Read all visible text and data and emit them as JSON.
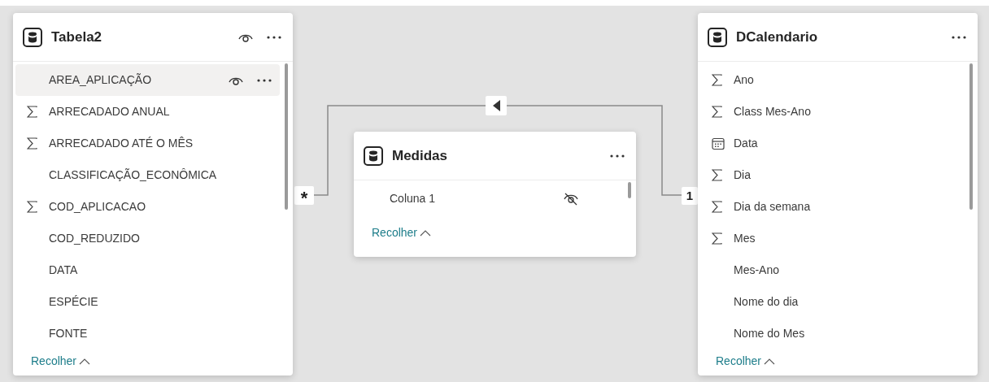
{
  "tables": [
    {
      "title": "Tabela2",
      "visibility_icon": true,
      "collapse_label": "Recolher",
      "fields": [
        {
          "name": "AREA_APLICAÇÃO",
          "kind": "text",
          "selected": true,
          "hidden": false
        },
        {
          "name": "ARRECADADO ANUAL",
          "kind": "sum",
          "selected": false,
          "hidden": false
        },
        {
          "name": "ARRECADADO ATÉ O MÊS",
          "kind": "sum",
          "selected": false,
          "hidden": false
        },
        {
          "name": "CLASSIFICAÇÃO_ECONÔMICA",
          "kind": "text",
          "selected": false,
          "hidden": false
        },
        {
          "name": "COD_APLICACAO",
          "kind": "sum",
          "selected": false,
          "hidden": false
        },
        {
          "name": "COD_REDUZIDO",
          "kind": "text",
          "selected": false,
          "hidden": false
        },
        {
          "name": "DATA",
          "kind": "text",
          "selected": false,
          "hidden": false
        },
        {
          "name": "ESPÉCIE",
          "kind": "text",
          "selected": false,
          "hidden": false
        },
        {
          "name": "FONTE",
          "kind": "text",
          "selected": false,
          "hidden": false
        }
      ]
    },
    {
      "title": "Medidas",
      "visibility_icon": false,
      "collapse_label": "Recolher",
      "fields": [
        {
          "name": "Coluna 1",
          "kind": "text",
          "selected": false,
          "hidden": true
        }
      ]
    },
    {
      "title": "DCalendario",
      "visibility_icon": false,
      "collapse_label": "Recolher",
      "fields": [
        {
          "name": "Ano",
          "kind": "sum",
          "selected": false,
          "hidden": false
        },
        {
          "name": "Class Mes-Ano",
          "kind": "sum",
          "selected": false,
          "hidden": false
        },
        {
          "name": "Data",
          "kind": "date",
          "selected": false,
          "hidden": false
        },
        {
          "name": "Dia",
          "kind": "sum",
          "selected": false,
          "hidden": false
        },
        {
          "name": "Dia da semana",
          "kind": "sum",
          "selected": false,
          "hidden": false
        },
        {
          "name": "Mes",
          "kind": "sum",
          "selected": false,
          "hidden": false
        },
        {
          "name": "Mes-Ano",
          "kind": "text",
          "selected": false,
          "hidden": false
        },
        {
          "name": "Nome do dia",
          "kind": "text",
          "selected": false,
          "hidden": false
        },
        {
          "name": "Nome do Mes",
          "kind": "text",
          "selected": false,
          "hidden": false
        }
      ]
    }
  ],
  "relationship": {
    "from_cardinality": "*",
    "to_cardinality": "1",
    "single_direction": true
  }
}
